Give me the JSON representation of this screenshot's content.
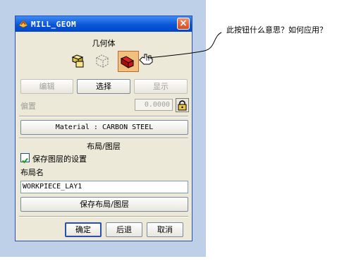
{
  "window": {
    "title": "MILL_GEOM",
    "close_label": "×"
  },
  "geometry": {
    "header": "几何体",
    "tools": [
      {
        "name": "part-geometry-icon"
      },
      {
        "name": "blank-geometry-icon"
      },
      {
        "name": "check-geometry-icon",
        "selected": true
      }
    ],
    "buttons": {
      "edit": "编辑",
      "select": "选择",
      "display": "显示"
    }
  },
  "offset": {
    "label": "偏置",
    "value": "0.0000"
  },
  "material": {
    "label": "Material : CARBON STEEL"
  },
  "layout": {
    "header": "布局/图层",
    "save_settings_label": "保存图层的设置",
    "save_settings_checked": true,
    "name_label": "布局名",
    "name_value": "WORKPIECE_LAY1",
    "save_button": "保存布局/图层"
  },
  "actions": {
    "ok": "确定",
    "back": "后退",
    "cancel": "取消"
  },
  "annotation": {
    "text": "此按钮什么意思？如何应用？"
  },
  "colors": {
    "titlebar": "#0a56d8",
    "dialog_bg": "#ece9d8",
    "backdrop": "#bdd0e8",
    "selected_tool": "#f2c07e"
  }
}
